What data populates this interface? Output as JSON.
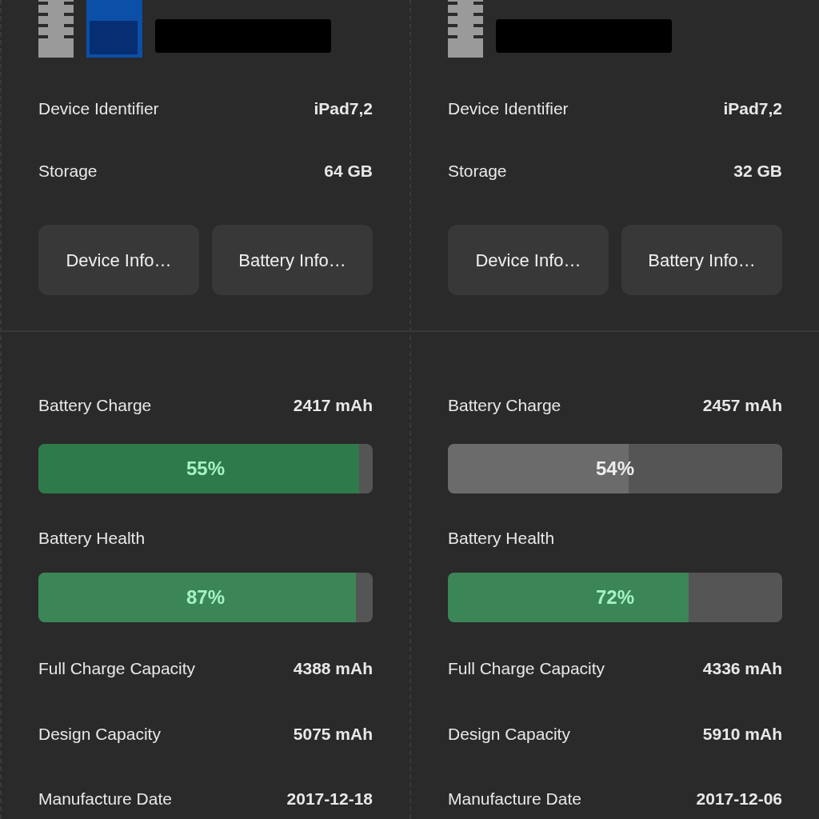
{
  "devices": [
    {
      "details": [
        {
          "label": "Device Identifier",
          "value": "iPad7,2"
        },
        {
          "label": "Storage",
          "value": "64 GB"
        }
      ],
      "buttons": [
        "Device Info…",
        "Battery Info…"
      ],
      "battery": {
        "charge": {
          "label": "Battery Charge",
          "reading": "2417 mAh",
          "level": 0.96,
          "percent": "55%",
          "color": "#2f7a4a"
        },
        "health": {
          "label": "Battery Health",
          "level": 0.95,
          "percent": "87%",
          "color": "#3b8557"
        },
        "details": [
          {
            "label": "Full Charge Capacity",
            "value": "4388 mAh"
          },
          {
            "label": "Design Capacity",
            "value": "5075 mAh"
          },
          {
            "label": "Manufacture Date",
            "value": "2017-12-18"
          }
        ]
      }
    },
    {
      "details": [
        {
          "label": "Device Identifier",
          "value": "iPad7,2"
        },
        {
          "label": "Storage",
          "value": "32 GB"
        }
      ],
      "buttons": [
        "Device Info…",
        "Battery Info…"
      ],
      "battery": {
        "charge": {
          "label": "Battery Charge",
          "reading": "2457 mAh",
          "level": 0.54,
          "percent": "54%",
          "color": "#6b6b6b"
        },
        "health": {
          "label": "Battery Health",
          "level": 0.72,
          "percent": "72%",
          "color": "#3b8557"
        },
        "details": [
          {
            "label": "Full Charge Capacity",
            "value": "4336 mAh"
          },
          {
            "label": "Design Capacity",
            "value": "5910 mAh"
          },
          {
            "label": "Manufacture Date",
            "value": "2017-12-06"
          }
        ]
      }
    }
  ]
}
